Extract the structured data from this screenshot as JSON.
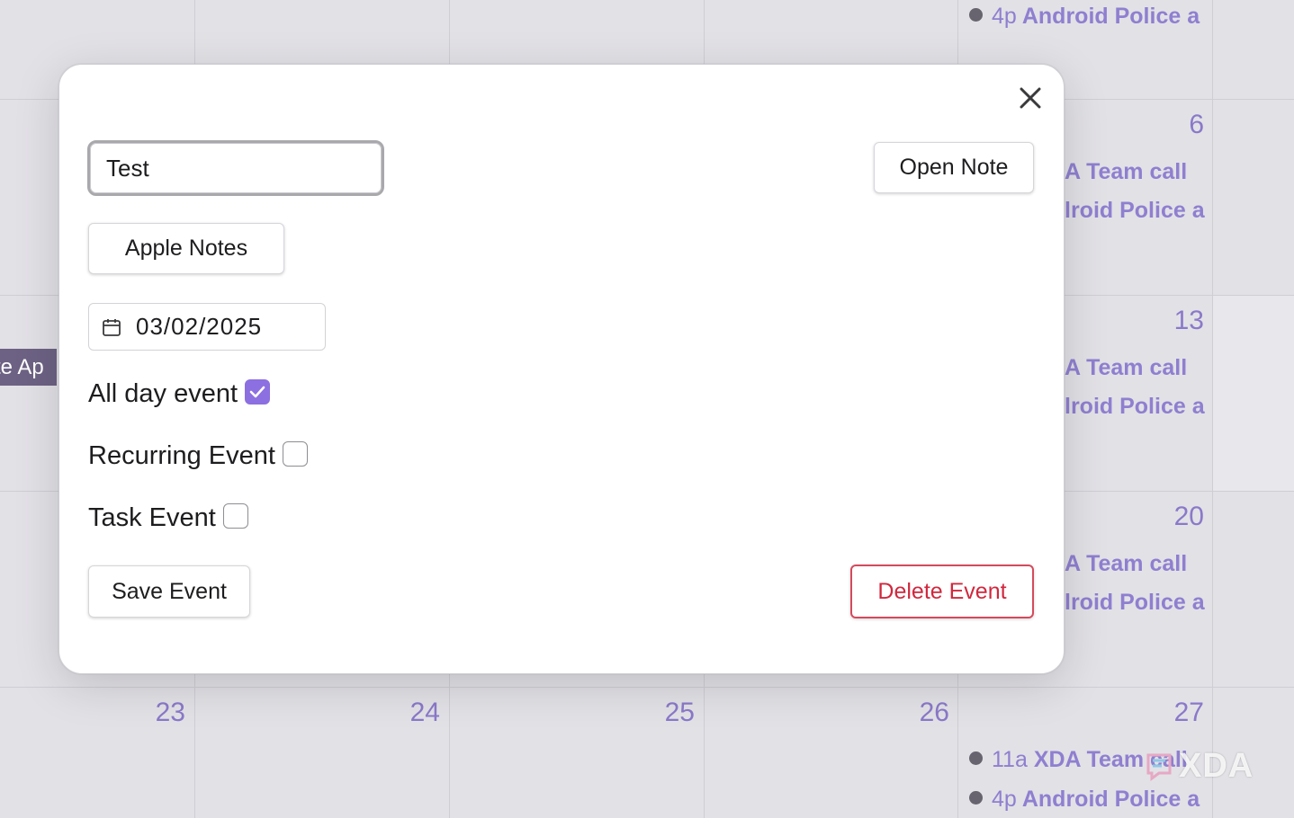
{
  "calendar": {
    "day_numbers": {
      "d6": "6",
      "d13": "13",
      "d20": "20",
      "d23": "23",
      "d24": "24",
      "d25": "25",
      "d26": "26",
      "d27": "27"
    },
    "all_day_chip_text": "te Ap",
    "events": {
      "top_time": "4p",
      "top_title": "Android Police a",
      "row1_call": "A Team call",
      "row1_police": "lroid Police a",
      "row2_call": "A Team call",
      "row2_police": "lroid Police a",
      "row3_call": "A Team call",
      "row3_police": "lroid Police a",
      "bottom1_time": "11a",
      "bottom1_title": "XDA Team call",
      "bottom2_time": "4p",
      "bottom2_title": "Android Police a"
    }
  },
  "modal": {
    "title_value": "Test",
    "open_note_label": "Open Note",
    "app_button_label": "Apple Notes",
    "date_value": "03/02/2025",
    "all_day_label": "All day event",
    "all_day_checked": true,
    "recurring_label": "Recurring Event",
    "recurring_checked": false,
    "task_label": "Task Event",
    "task_checked": false,
    "save_label": "Save Event",
    "delete_label": "Delete Event"
  },
  "watermark": {
    "text": "XDA"
  },
  "colors": {
    "accent_purple": "#8c6fe0",
    "event_purple": "#8f7fd0",
    "delete_red": "#d0283e"
  },
  "icons": {
    "close": "close-icon",
    "date": "calendar-icon",
    "check": "checkmark-icon"
  }
}
